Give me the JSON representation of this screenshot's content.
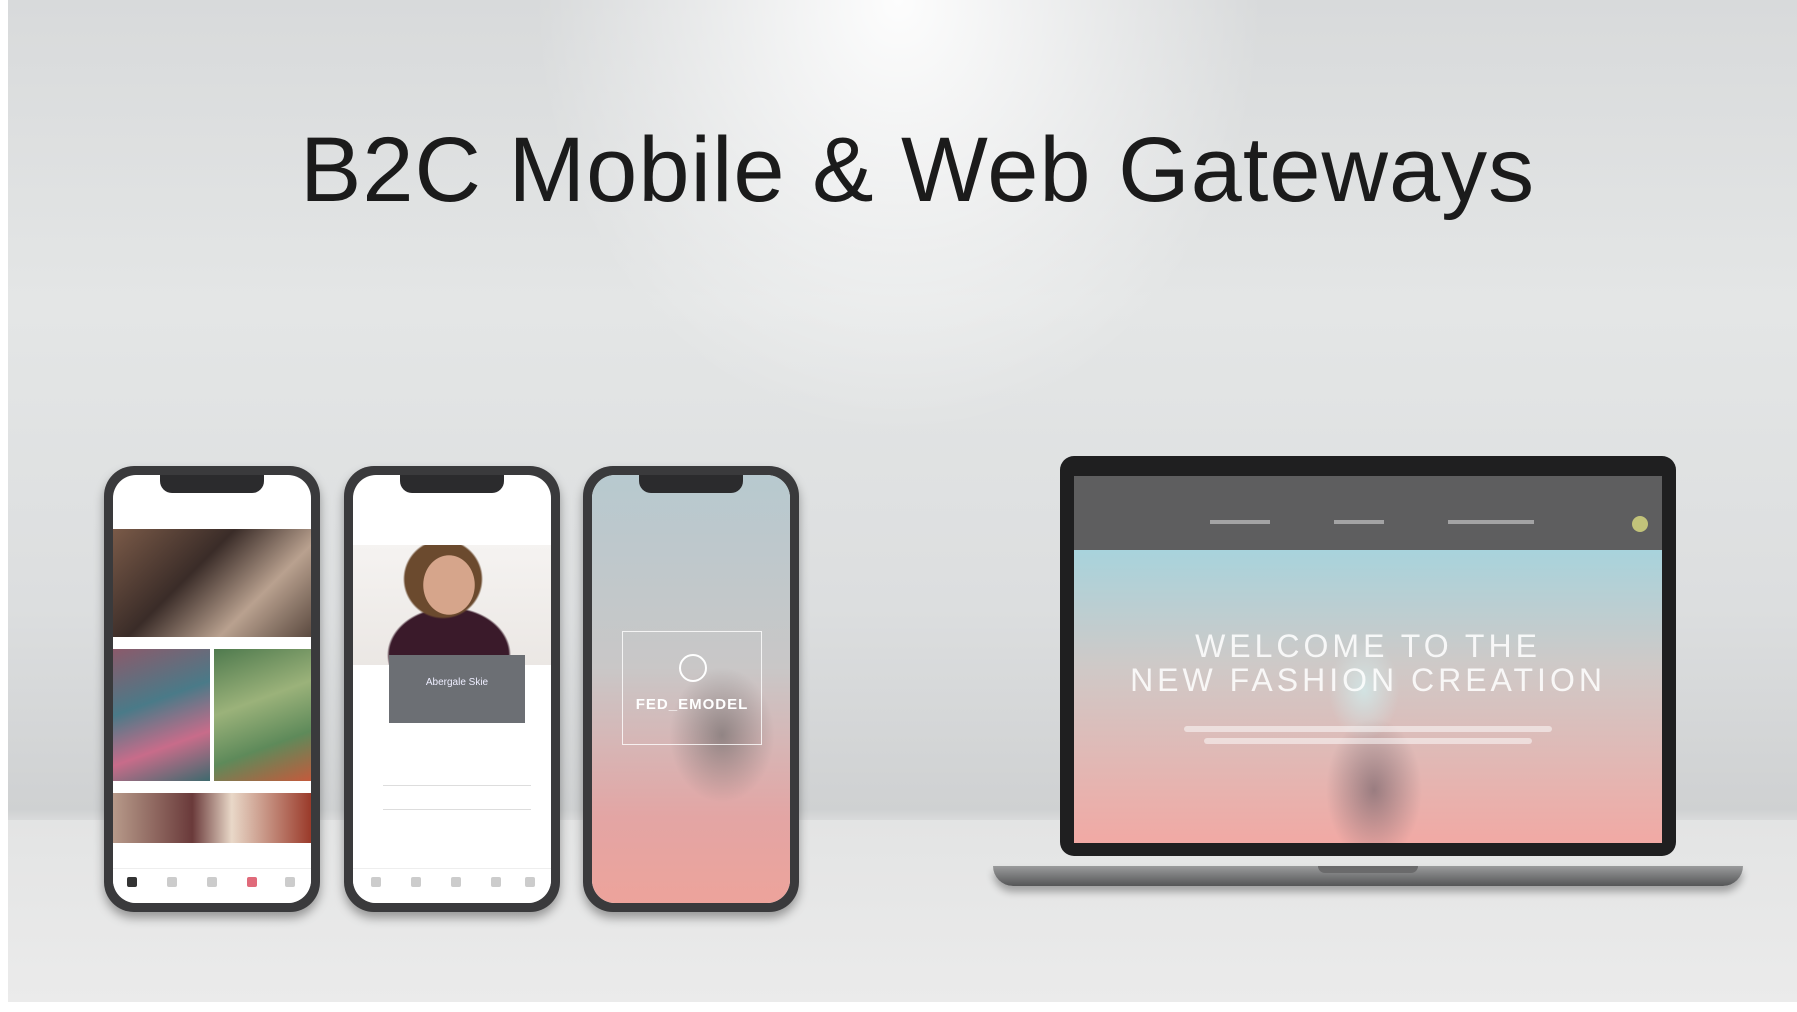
{
  "title": "B2C Mobile & Web Gateways",
  "phone_login": {
    "brand": "Abergale Skie"
  },
  "phone_splash": {
    "logo": "FED_EMODEL"
  },
  "laptop": {
    "hero_line1": "WELCOME TO THE",
    "hero_line2": "NEW FASHION CREATION"
  },
  "colors": {
    "hero_top": "#a8d3dc",
    "hero_bottom": "#f1a9a4",
    "nav_bg": "#5e5e5f"
  }
}
